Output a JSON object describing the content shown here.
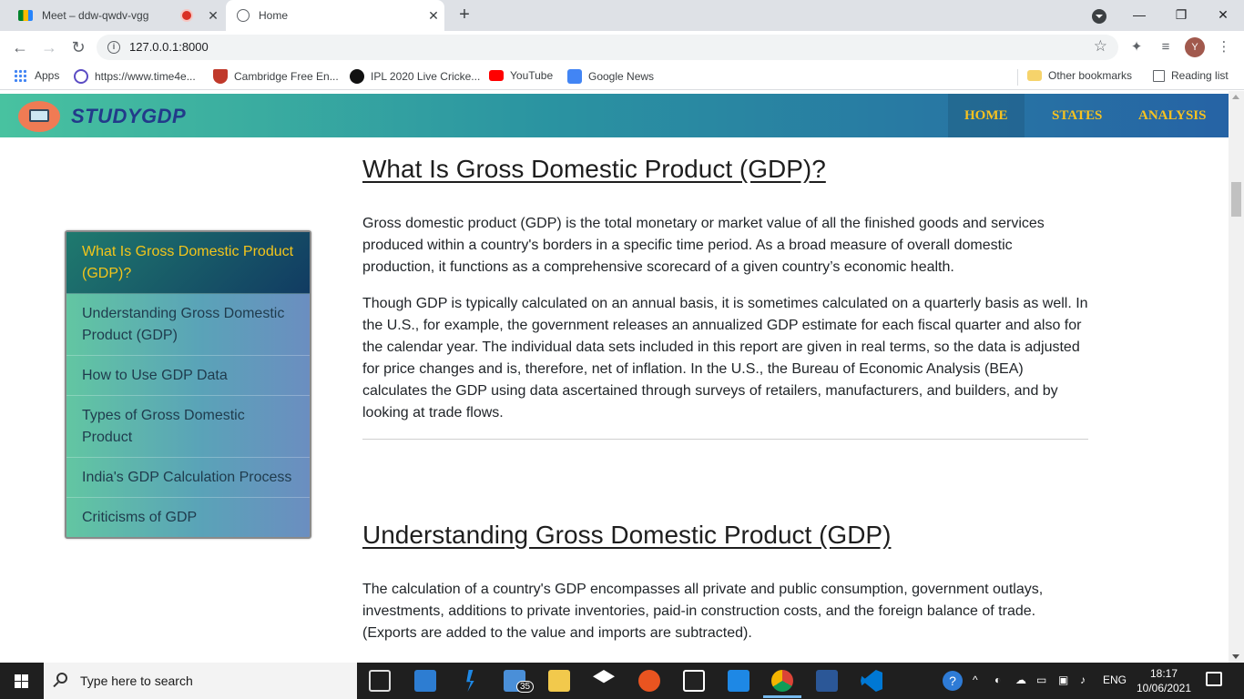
{
  "browser": {
    "tabs": [
      {
        "title": "Meet – ddw-qwdv-vgg",
        "active": false
      },
      {
        "title": "Home",
        "active": true
      }
    ],
    "url": "127.0.0.1:8000",
    "bookmarks": [
      {
        "label": "Apps"
      },
      {
        "label": "https://www.time4e..."
      },
      {
        "label": "Cambridge Free En..."
      },
      {
        "label": "IPL 2020 Live Cricke..."
      },
      {
        "label": "YouTube"
      },
      {
        "label": "Google News"
      },
      {
        "label": "Other bookmarks"
      },
      {
        "label": "Reading list"
      }
    ],
    "profile_initial": "Y"
  },
  "site": {
    "logo_text": "STUDYGDP",
    "nav": [
      {
        "label": "HOME",
        "active": true
      },
      {
        "label": "STATES",
        "active": false
      },
      {
        "label": "ANALYSIS",
        "active": false
      }
    ]
  },
  "toc": [
    {
      "label": "What Is Gross Domestic Product (GDP)?",
      "active": true
    },
    {
      "label": "Understanding Gross Domestic Product (GDP)",
      "active": false
    },
    {
      "label": "How to Use GDP Data",
      "active": false
    },
    {
      "label": "Types of Gross Domestic Product",
      "active": false
    },
    {
      "label": "India's GDP Calculation Process",
      "active": false
    },
    {
      "label": "Criticisms of GDP",
      "active": false
    }
  ],
  "sections": [
    {
      "heading": "What Is Gross Domestic Product (GDP)?",
      "paragraphs": [
        "Gross domestic product (GDP) is the total monetary or market value of all the finished goods and services produced within a country's borders in a specific time period. As a broad measure of overall domestic production, it functions as a comprehensive scorecard of a given country’s economic health.",
        "Though GDP is typically calculated on an annual basis, it is sometimes calculated on a quarterly basis as well. In the U.S., for example, the government releases an annualized GDP estimate for each fiscal quarter and also for the calendar year. The individual data sets included in this report are given in real terms, so the data is adjusted for price changes and is, therefore, net of inflation. In the U.S., the Bureau of Economic Analysis (BEA) calculates the GDP using data ascertained through surveys of retailers, manufacturers, and builders, and by looking at trade flows."
      ]
    },
    {
      "heading": "Understanding Gross Domestic Product (GDP)",
      "paragraphs": [
        "The calculation of a country's GDP encompasses all private and public consumption, government outlays, investments, additions to private inventories, paid-in construction costs, and the foreign balance of trade. (Exports are added to the value and imports are subtracted)."
      ]
    }
  ],
  "taskbar": {
    "search_placeholder": "Type here to search",
    "mail_badge": "35",
    "language": "ENG",
    "time": "18:17",
    "date": "10/06/2021"
  },
  "colors": {
    "nav_gradient_start": "#48c2a0",
    "nav_gradient_end": "#2663a5",
    "nav_link": "#f7c21f",
    "toc_active_text": "#f3c51b"
  }
}
